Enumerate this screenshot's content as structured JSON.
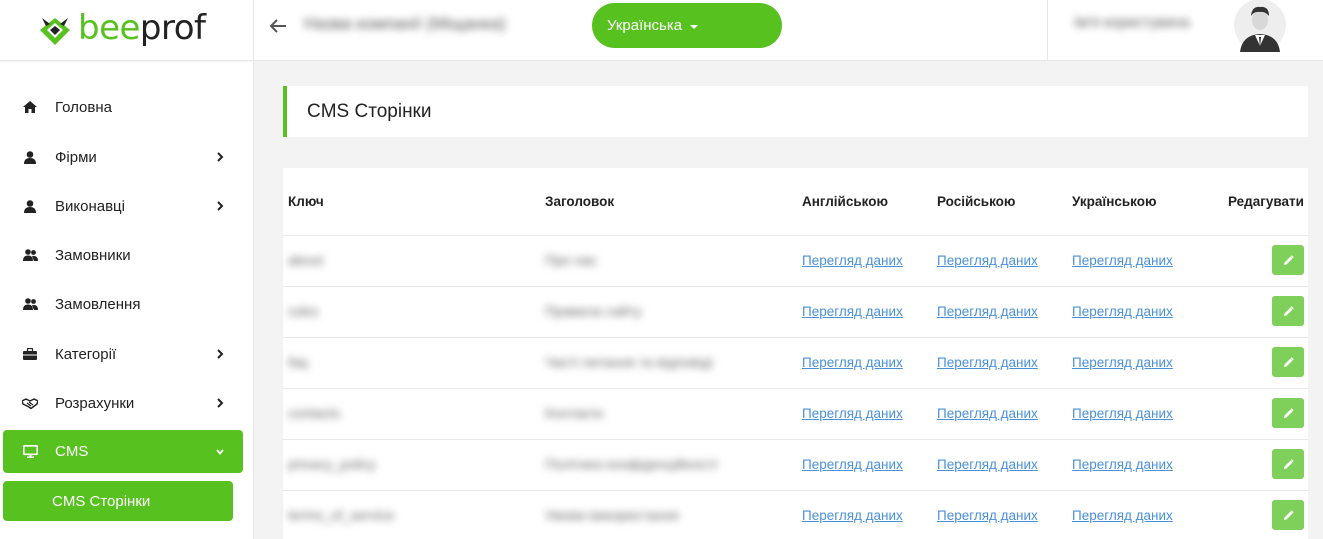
{
  "brand": {
    "part1": "bee",
    "part2": "prof",
    "accent": "#57c11f"
  },
  "header": {
    "company_name": "Назва компанії (Міщанка)",
    "language_label": "Українська",
    "user_name": "Ім'я користувача"
  },
  "sidebar": {
    "items": [
      {
        "label": "Головна",
        "icon": "home-icon"
      },
      {
        "label": "Фірми",
        "icon": "user-icon",
        "has_children": true
      },
      {
        "label": "Виконавці",
        "icon": "user-icon",
        "has_children": true
      },
      {
        "label": "Замовники",
        "icon": "users-icon"
      },
      {
        "label": "Замовлення",
        "icon": "users-icon"
      },
      {
        "label": "Категорії",
        "icon": "briefcase-icon",
        "has_children": true
      },
      {
        "label": "Розрахунки",
        "icon": "handshake-icon",
        "has_children": true
      },
      {
        "label": "CMS",
        "icon": "monitor-icon",
        "expanded": true
      }
    ],
    "sub_items": [
      {
        "label": "CMS Сторінки"
      }
    ]
  },
  "main": {
    "title": "CMS Сторінки",
    "table": {
      "columns": [
        "Ключ",
        "Заголовок",
        "Англійською",
        "Російською",
        "Українською",
        "Редагувати"
      ],
      "rows": [
        {
          "key": "about",
          "title": "Про нас",
          "en": "Перегляд даних",
          "ru": "Перегляд даних",
          "uk": "Перегляд даних"
        },
        {
          "key": "rules",
          "title": "Правила сайту",
          "en": "Перегляд даних",
          "ru": "Перегляд даних",
          "uk": "Перегляд даних"
        },
        {
          "key": "faq",
          "title": "Часті питання та відповіді",
          "en": "Перегляд даних",
          "ru": "Перегляд даних",
          "uk": "Перегляд даних"
        },
        {
          "key": "contacts",
          "title": "Контакти",
          "en": "Перегляд даних",
          "ru": "Перегляд даних",
          "uk": "Перегляд даних"
        },
        {
          "key": "privacy_policy",
          "title": "Політика конфіденційності",
          "en": "Перегляд даних",
          "ru": "Перегляд даних",
          "uk": "Перегляд даних"
        },
        {
          "key": "terms_of_service",
          "title": "Умови використання",
          "en": "Перегляд даних",
          "ru": "Перегляд даних",
          "uk": "Перегляд даних"
        }
      ]
    }
  }
}
